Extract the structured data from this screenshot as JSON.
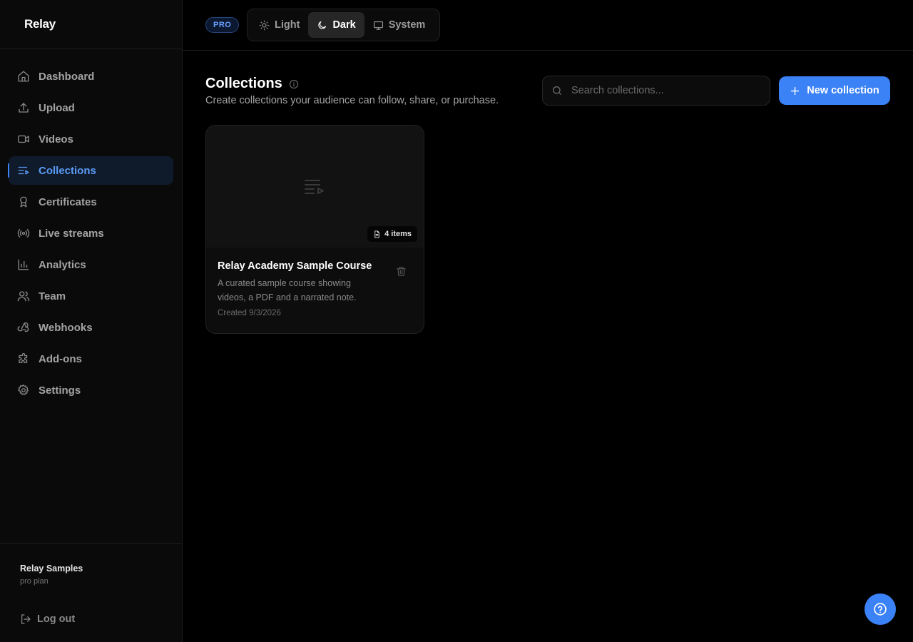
{
  "app": {
    "logo": "Relay"
  },
  "sidebar": {
    "items": [
      {
        "label": "Dashboard",
        "icon": "home-icon"
      },
      {
        "label": "Upload",
        "icon": "upload-icon"
      },
      {
        "label": "Videos",
        "icon": "video-icon"
      },
      {
        "label": "Collections",
        "icon": "list-play-icon",
        "active": true
      },
      {
        "label": "Certificates",
        "icon": "award-icon"
      },
      {
        "label": "Live streams",
        "icon": "radio-icon"
      },
      {
        "label": "Analytics",
        "icon": "bar-chart-icon"
      },
      {
        "label": "Team",
        "icon": "users-icon"
      },
      {
        "label": "Webhooks",
        "icon": "webhook-icon"
      },
      {
        "label": "Add-ons",
        "icon": "puzzle-icon"
      },
      {
        "label": "Settings",
        "icon": "gear-icon"
      }
    ],
    "org_name": "Relay Samples",
    "org_plan": "pro plan",
    "logout_label": "Log out"
  },
  "topbar": {
    "plan_badge": "PRO",
    "theme_options": [
      {
        "label": "Light",
        "icon": "sun-icon"
      },
      {
        "label": "Dark",
        "icon": "moon-icon",
        "active": true
      },
      {
        "label": "System",
        "icon": "monitor-icon"
      }
    ]
  },
  "main": {
    "title": "Collections",
    "subtitle": "Create collections your audience can follow, share, or purchase.",
    "search_placeholder": "Search collections...",
    "new_button_label": "New collection",
    "collections": [
      {
        "title": "Relay Academy Sample Course",
        "description": "A curated sample course showing videos, a PDF and a narrated note.",
        "items_label": "4 items",
        "created": "Created 9/3/2026"
      }
    ]
  },
  "colors": {
    "accent": "#3b82f6",
    "background": "#000000",
    "sidebar": "#0a0a0a",
    "active_nav_text": "#5b9cf5"
  }
}
